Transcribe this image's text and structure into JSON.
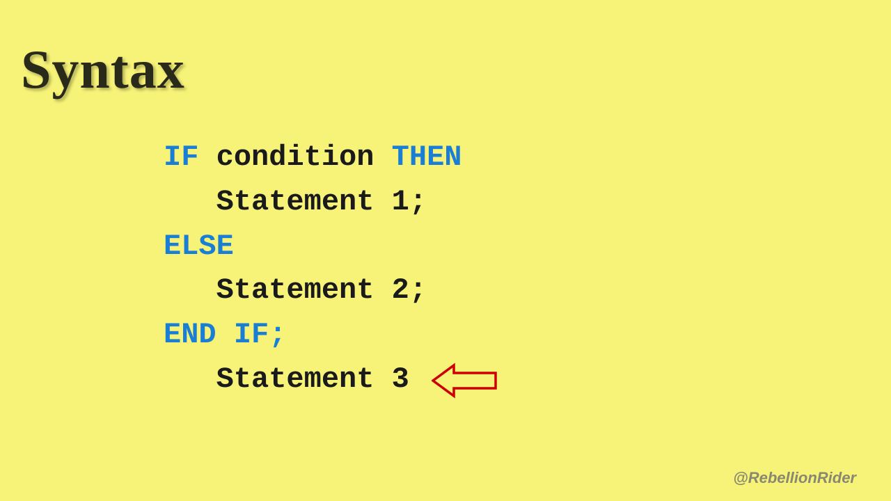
{
  "title": "Syntax",
  "code": {
    "line1": {
      "kw1": "IF",
      "txt1": " condition  ",
      "kw2": "THEN"
    },
    "line2": "   Statement 1;",
    "line3": "ELSE",
    "line4": "   Statement 2;",
    "line5": "END IF;",
    "line6": "   Statement 3"
  },
  "watermark": "@RebellionRider"
}
